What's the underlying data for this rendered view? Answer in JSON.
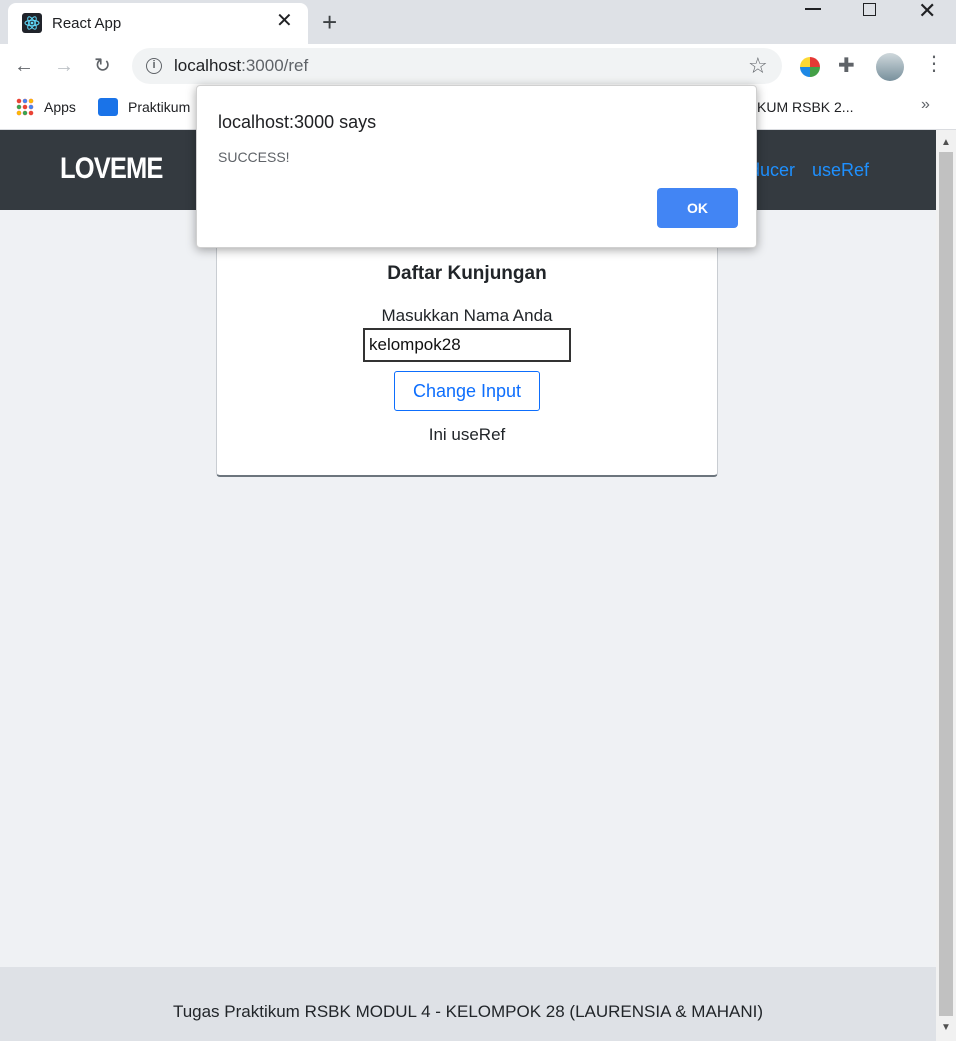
{
  "browser": {
    "tab_title": "React App",
    "tab_close": "✕",
    "new_tab": "+",
    "url_host": "localhost",
    "url_path": ":3000/ref",
    "star": "☆",
    "extension": "✚",
    "menu": "⋮",
    "back": "←",
    "forward": "→",
    "reload": "↻",
    "info": "i",
    "window_close": "✕"
  },
  "bookmarks": {
    "apps_label": "Apps",
    "praktikum_label": "Praktikum",
    "tail_label": "KUM RSBK 2...",
    "more": "»"
  },
  "navbar": {
    "brand": "LOVEME",
    "link_reducer": "ducer",
    "link_useref": "useRef"
  },
  "card": {
    "title": "Daftar Kunjungan",
    "label": "Masukkan Nama Anda",
    "input_value": "kelompok28",
    "button_label": "Change Input",
    "status": "Ini useRef"
  },
  "footer": {
    "text": "Tugas Praktikum RSBK MODUL 4 - KELOMPOK 28 (LAURENSIA & MAHANI)"
  },
  "scrollbar": {
    "up": "▲",
    "down": "▼"
  },
  "dialog": {
    "title": "localhost:3000 says",
    "message": "SUCCESS!",
    "ok_label": "OK"
  }
}
